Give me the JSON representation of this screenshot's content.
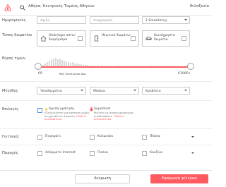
{
  "header": {
    "search_text": "Αθήνα, Κεντρικός Τομέας Αθηνών",
    "user_link": "Φιλοξενία"
  },
  "dates": {
    "label": "Ημερομηνίες",
    "checkin_placeholder": "Άφιξη",
    "checkout_placeholder": "Αναχώρηση",
    "guests_value": "1 Επισκέπτης"
  },
  "room_type": {
    "label": "Τύπος δωματίου",
    "options": [
      {
        "label": "Ολόκληρο σπίτι/ διαμέρισμα",
        "icon": "house-icon",
        "checked": false
      },
      {
        "label": "Ιδιωτικό δωμάτιο",
        "icon": "door-icon",
        "checked": false
      },
      {
        "label": "Κοινόχρηστο δωμάτιο",
        "icon": "couch-icon",
        "checked": false
      }
    ]
  },
  "price": {
    "label": "Εύρος τιμών",
    "min": "€9",
    "max": "€1000+",
    "average": "€61 Κατά μέσο όρο"
  },
  "size": {
    "label": "Μέγεθος",
    "selects": [
      "Υπνοδωμάτια",
      "Μπάνια",
      "Κρεβάτια"
    ]
  },
  "options": {
    "label": "Επιλογές",
    "instant_book": {
      "title": "Άμεση κράτηση",
      "description": "Εξειδικεύεται για κράτηση χωρίς να χρειάζεται έγκριση.",
      "link": "Μάθετε περισσότερα",
      "checked": false
    },
    "superhost": {
      "title": "Superhost",
      "description": "Μείνετε με αναγνωρισμένους οικοδεσπότες.",
      "link": "Μάθετε περισσότερα"
    }
  },
  "neighborhoods": {
    "label": "Γειτονιές",
    "items": [
      "Παγκράτι",
      "Κολωνάκι",
      "Πλάκα"
    ]
  },
  "amenities": {
    "label": "Παροχές",
    "items": [
      "Ασύρματο Internet",
      "Πισίνα",
      "Κουζίνα"
    ]
  },
  "footer": {
    "cancel_label": "Ακύρωση",
    "apply_label": "Εφαρμογή φίλτρων"
  },
  "colors": {
    "accent": "#ff5a5f",
    "text": "#484848",
    "border": "#c8c8c8"
  }
}
